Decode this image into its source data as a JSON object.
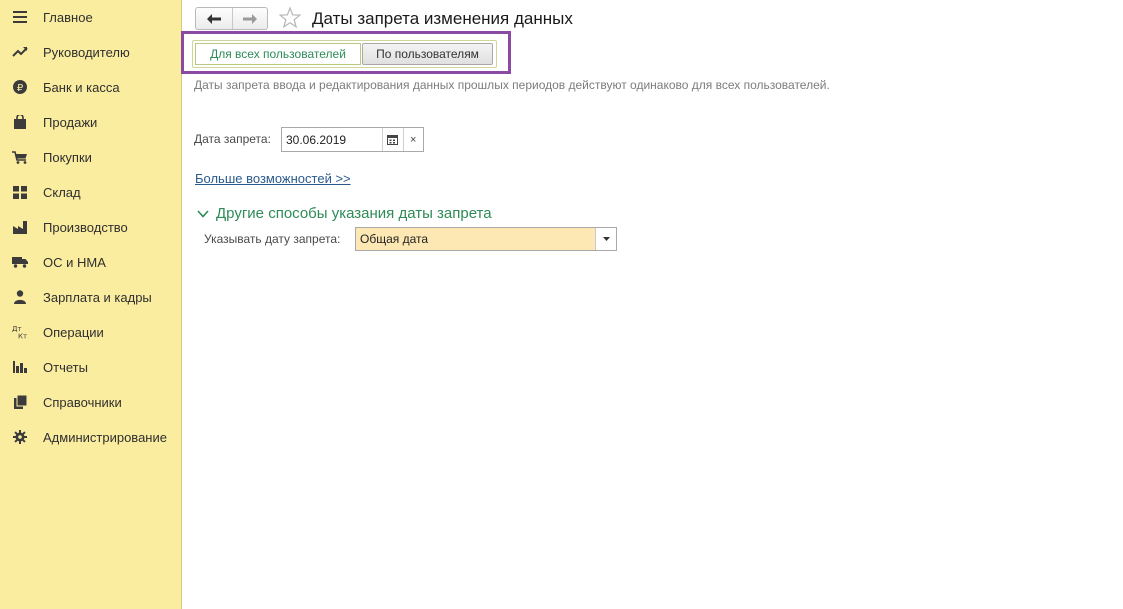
{
  "sidebar": {
    "items": [
      {
        "label": "Главное",
        "icon": "menu-icon"
      },
      {
        "label": "Руководителю",
        "icon": "trend-icon"
      },
      {
        "label": "Банк и касса",
        "icon": "ruble-icon"
      },
      {
        "label": "Продажи",
        "icon": "shopping-bag-icon"
      },
      {
        "label": "Покупки",
        "icon": "cart-icon"
      },
      {
        "label": "Склад",
        "icon": "warehouse-grid-icon"
      },
      {
        "label": "Производство",
        "icon": "factory-icon"
      },
      {
        "label": "ОС и НМА",
        "icon": "truck-icon"
      },
      {
        "label": "Зарплата и кадры",
        "icon": "person-icon"
      },
      {
        "label": "Операции",
        "icon": "dt-kt-icon"
      },
      {
        "label": "Отчеты",
        "icon": "bar-chart-icon"
      },
      {
        "label": "Справочники",
        "icon": "books-icon"
      },
      {
        "label": "Администрирование",
        "icon": "gear-icon"
      }
    ],
    "background": "#fbeda0"
  },
  "header": {
    "title": "Даты запрета изменения данных",
    "back_icon": "arrow-left-icon",
    "forward_icon": "arrow-right-icon",
    "favorite_icon": "star-icon"
  },
  "tabs": {
    "all_users": "Для всех пользователей",
    "by_users": "По пользователям",
    "active": "all_users",
    "highlight_color": "#8c4aa3"
  },
  "hint": "Даты запрета ввода и редактирования данных прошлых периодов действуют одинаково для всех пользователей.",
  "date_field": {
    "label": "Дата запрета:",
    "value": "30.06.2019",
    "calendar_icon": "calendar-icon",
    "clear_label": "×"
  },
  "more_link": "Больше возможностей >>",
  "group": {
    "title": "Другие способы указания даты запрета",
    "expanded": true,
    "field_label": "Указывать дату запрета:",
    "field_value": "Общая дата"
  },
  "colors": {
    "accent_green": "#2e8b57",
    "link_blue": "#2a5a8c",
    "select_bg": "#fde7b3"
  }
}
